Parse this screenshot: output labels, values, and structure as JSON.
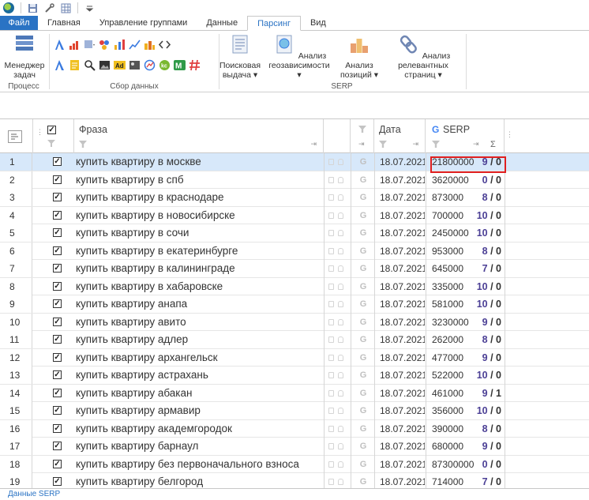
{
  "ribbon": {
    "tabs": [
      "Файл",
      "Главная",
      "Управление группами",
      "Данные",
      "Парсинг",
      "Вид"
    ],
    "active_tab": "Парсинг",
    "process_group": {
      "label": "Процесс",
      "manager_btn": "Менеджер\nзадач"
    },
    "collect_group": {
      "label": "Сбор данных"
    },
    "serp_group": {
      "label": "SERP",
      "buttons": [
        "Поисковая\nвыдача ▾",
        "Анализ\nгеозависимости ▾",
        "Анализ\nпозиций ▾",
        "Анализ релевантных\nстраниц ▾"
      ]
    }
  },
  "grid": {
    "headers": {
      "phrase": "Фраза",
      "date": "Дата",
      "serp": "SERP",
      "sigma": "Σ"
    },
    "rows": [
      {
        "n": "1",
        "phrase": "купить квартиру в москве",
        "date": "18.07.2021",
        "serp": "21800000",
        "pos": "9",
        "zero": "0"
      },
      {
        "n": "2",
        "phrase": "купить квартиру в спб",
        "date": "18.07.2021",
        "serp": "3620000",
        "pos": "0",
        "zero": "0"
      },
      {
        "n": "3",
        "phrase": "купить квартиру в краснодаре",
        "date": "18.07.2021",
        "serp": "873000",
        "pos": "8",
        "zero": "0"
      },
      {
        "n": "4",
        "phrase": "купить квартиру в новосибирске",
        "date": "18.07.2021",
        "serp": "700000",
        "pos": "10",
        "zero": "0"
      },
      {
        "n": "5",
        "phrase": "купить квартиру в сочи",
        "date": "18.07.2021",
        "serp": "2450000",
        "pos": "10",
        "zero": "0"
      },
      {
        "n": "6",
        "phrase": "купить квартиру в екатеринбурге",
        "date": "18.07.2021",
        "serp": "953000",
        "pos": "8",
        "zero": "0"
      },
      {
        "n": "7",
        "phrase": "купить квартиру в калининграде",
        "date": "18.07.2021",
        "serp": "645000",
        "pos": "7",
        "zero": "0"
      },
      {
        "n": "8",
        "phrase": "купить квартиру в хабаровске",
        "date": "18.07.2021",
        "serp": "335000",
        "pos": "10",
        "zero": "0"
      },
      {
        "n": "9",
        "phrase": "купить квартиру анапа",
        "date": "18.07.2021",
        "serp": "581000",
        "pos": "10",
        "zero": "0"
      },
      {
        "n": "10",
        "phrase": "купить квартиру авито",
        "date": "18.07.2021",
        "serp": "3230000",
        "pos": "9",
        "zero": "0"
      },
      {
        "n": "11",
        "phrase": "купить квартиру адлер",
        "date": "18.07.2021",
        "serp": "262000",
        "pos": "8",
        "zero": "0"
      },
      {
        "n": "12",
        "phrase": "купить квартиру архангельск",
        "date": "18.07.2021",
        "serp": "477000",
        "pos": "9",
        "zero": "0"
      },
      {
        "n": "13",
        "phrase": "купить квартиру астрахань",
        "date": "18.07.2021",
        "serp": "522000",
        "pos": "10",
        "zero": "0"
      },
      {
        "n": "14",
        "phrase": "купить квартиру абакан",
        "date": "18.07.2021",
        "serp": "461000",
        "pos": "9",
        "zero": "1"
      },
      {
        "n": "15",
        "phrase": "купить квартиру армавир",
        "date": "18.07.2021",
        "serp": "356000",
        "pos": "10",
        "zero": "0"
      },
      {
        "n": "16",
        "phrase": "купить квартиру академгородок",
        "date": "18.07.2021",
        "serp": "390000",
        "pos": "8",
        "zero": "0"
      },
      {
        "n": "17",
        "phrase": "купить квартиру барнаул",
        "date": "18.07.2021",
        "serp": "680000",
        "pos": "9",
        "zero": "0"
      },
      {
        "n": "18",
        "phrase": "купить квартиру без первоначального взноса",
        "date": "18.07.2021",
        "serp": "87300000",
        "pos": "0",
        "zero": "0"
      },
      {
        "n": "19",
        "phrase": "купить квартиру белгород",
        "date": "18.07.2021",
        "serp": "714000",
        "pos": "7",
        "zero": "0"
      }
    ]
  },
  "status": {
    "text": "Данные SERP"
  },
  "colors": {
    "accent": "#2a73c4",
    "selection": "#d7e8fa",
    "highlight": "#e02020",
    "pos": "#4b3f95"
  }
}
